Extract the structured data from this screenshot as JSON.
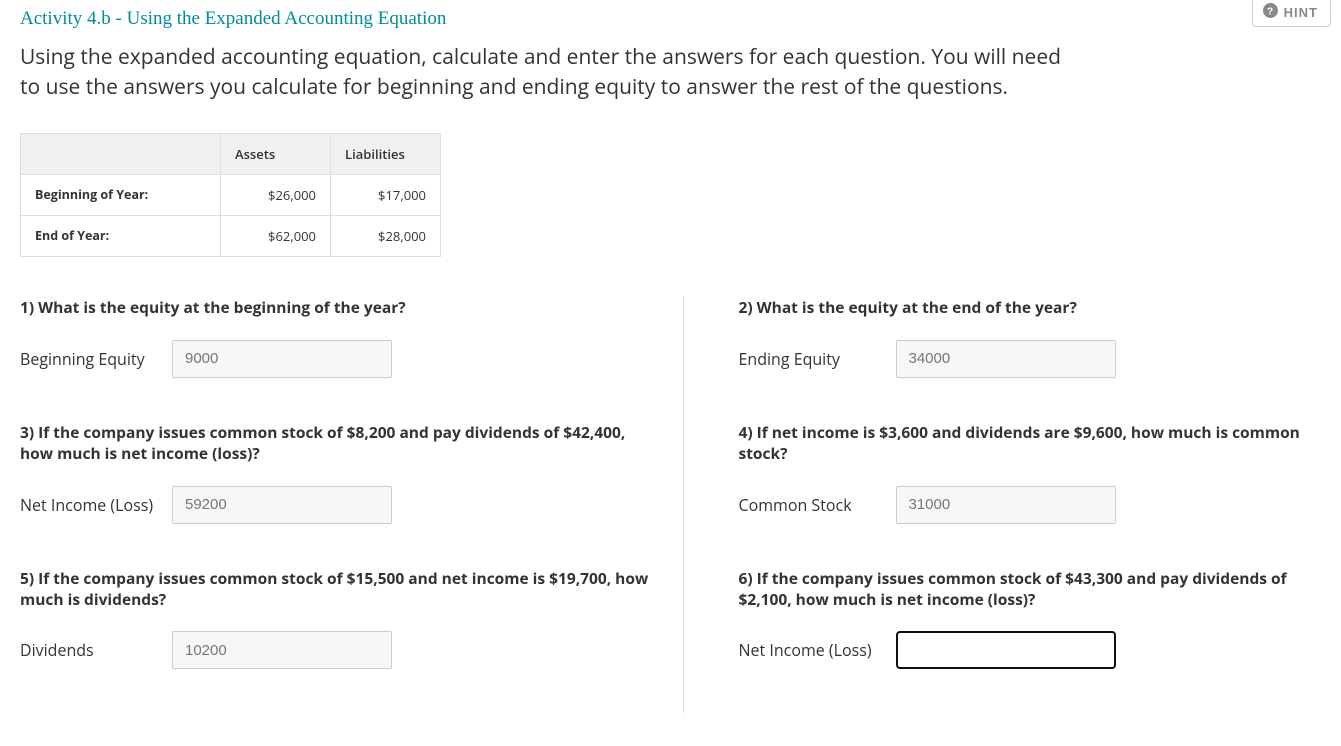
{
  "hint": {
    "label": "HINT"
  },
  "title": "Activity 4.b - Using the Expanded Accounting Equation",
  "instructions": "Using the expanded accounting equation, calculate and enter the answers for each question. You will need to use the answers you calculate for beginning and ending equity to answer the rest of the questions.",
  "table": {
    "headers": {
      "col1": "Assets",
      "col2": "Liabilities"
    },
    "rows": [
      {
        "label": "Beginning of Year:",
        "assets": "$26,000",
        "liabilities": "$17,000"
      },
      {
        "label": "End of Year:",
        "assets": "$62,000",
        "liabilities": "$28,000"
      }
    ]
  },
  "questions": {
    "q1": {
      "text": "1) What is the equity at the beginning of the year?",
      "label": "Beginning Equity",
      "value": "9000"
    },
    "q2": {
      "text": "2) What is the equity at the end of the year?",
      "label": "Ending Equity",
      "value": "34000"
    },
    "q3": {
      "text": "3) If the company issues common stock of $8,200 and pay dividends of $42,400, how much is net income (loss)?",
      "label": "Net Income (Loss)",
      "value": "59200"
    },
    "q4": {
      "text": "4) If net income is $3,600 and dividends are $9,600, how much is common stock?",
      "label": "Common Stock",
      "value": "31000"
    },
    "q5": {
      "text": "5) If the company issues common stock of $15,500 and net income is $19,700, how much is dividends?",
      "label": "Dividends",
      "value": "10200"
    },
    "q6": {
      "text": "6) If the company issues common stock of $43,300 and pay dividends of $2,100, how much is net income (loss)?",
      "label": "Net Income (Loss)",
      "value": ""
    }
  }
}
